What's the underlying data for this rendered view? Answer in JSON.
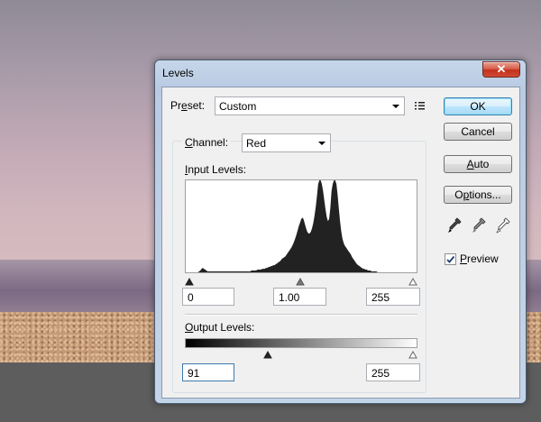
{
  "dialog": {
    "title": "Levels",
    "close_label": "✕",
    "preset": {
      "label": "Preset:",
      "value": "Custom"
    },
    "channel": {
      "label": "Channel:",
      "value": "Red"
    },
    "input_levels": {
      "label": "Input Levels:",
      "black": "0",
      "gamma": "1.00",
      "white": "255"
    },
    "output_levels": {
      "label": "Output Levels:",
      "black": "91",
      "white": "255"
    },
    "buttons": {
      "ok": "OK",
      "cancel": "Cancel",
      "auto": "Auto",
      "options": "Options..."
    },
    "preview": {
      "label": "Preview",
      "checked": true
    }
  },
  "icons": [
    "preset-menu-icon",
    "black-eyedropper-icon",
    "gray-eyedropper-icon",
    "white-eyedropper-icon",
    "checkmark-icon"
  ],
  "histogram_bins": [
    0,
    0,
    0,
    0,
    0,
    0,
    0,
    0,
    0,
    0,
    0,
    1,
    2,
    4,
    5,
    4,
    3,
    2,
    1,
    1,
    1,
    1,
    1,
    1,
    1,
    1,
    1,
    1,
    1,
    1,
    1,
    1,
    1,
    1,
    1,
    1,
    1,
    1,
    1,
    1,
    1,
    1,
    1,
    1,
    1,
    1,
    1,
    1,
    1,
    1,
    1,
    1,
    1,
    1,
    2,
    2,
    2,
    2,
    2,
    3,
    3,
    3,
    3,
    4,
    4,
    4,
    5,
    5,
    6,
    6,
    7,
    7,
    8,
    8,
    9,
    10,
    11,
    12,
    13,
    15,
    16,
    17,
    18,
    20,
    22,
    24,
    26,
    28,
    31,
    34,
    38,
    42,
    47,
    52,
    56,
    60,
    62,
    60,
    55,
    50,
    46,
    44,
    44,
    46,
    50,
    56,
    64,
    74,
    86,
    100,
    104,
    104,
    100,
    92,
    82,
    72,
    63,
    58,
    60,
    72,
    92,
    100,
    104,
    104,
    100,
    88,
    72,
    58,
    46,
    38,
    33,
    30,
    28,
    26,
    24,
    22,
    20,
    17,
    15,
    13,
    11,
    9,
    8,
    7,
    6,
    5,
    4,
    4,
    3,
    3,
    2,
    2,
    2,
    1,
    1,
    1,
    1,
    1,
    0,
    0,
    0,
    0,
    0,
    0,
    0,
    0,
    0,
    0,
    0,
    0,
    0,
    0,
    0,
    0,
    0,
    0,
    0,
    0,
    0,
    0,
    0,
    0,
    0,
    0,
    0,
    0,
    0,
    0,
    0,
    0,
    0
  ],
  "colors": {
    "accent": "#3c7fb1",
    "close": "#c2301c",
    "titlebar": "#c6d6ea"
  }
}
